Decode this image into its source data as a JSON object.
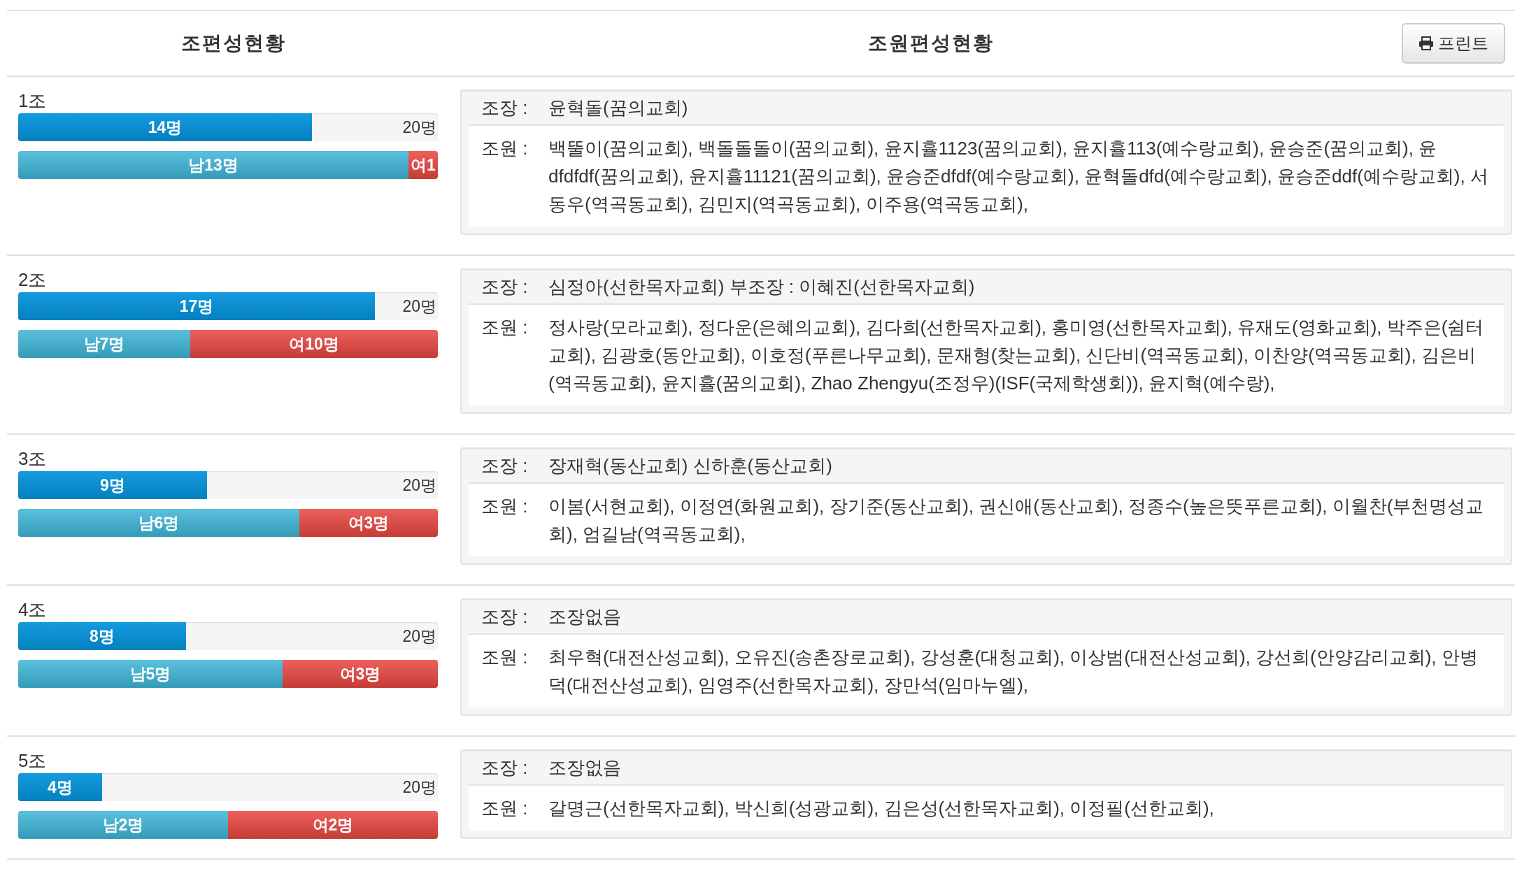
{
  "header": {
    "groups_title": "조편성현황",
    "members_title": "조원편성현황",
    "print_button": "프린트"
  },
  "groups": [
    {
      "name": "1조",
      "count": {
        "label": "14명",
        "level": 0.7
      },
      "capacity": "20명",
      "male": {
        "label": "남13명",
        "level": 0.93
      },
      "female": {
        "label": "여1",
        "level": 0.07
      },
      "leader_label": "조장 :",
      "leader": "윤혁돌(꿈의교회)",
      "members_label": "조원 :",
      "members": "백뚤이(꿈의교회), 백돌돌돌이(꿈의교회), 윤지휼1123(꿈의교회), 윤지휼113(예수랑교회), 윤승준(꿈의교회), 윤dfdfdf(꿈의교회), 윤지휼11121(꿈의교회), 윤승준dfdf(예수랑교회), 윤혁돌dfd(예수랑교회), 윤승준ddf(예수랑교회), 서동우(역곡동교회), 김민지(역곡동교회), 이주용(역곡동교회),"
    },
    {
      "name": "2조",
      "count": {
        "label": "17명",
        "level": 0.85
      },
      "capacity": "20명",
      "male": {
        "label": "남7명",
        "level": 0.41
      },
      "female": {
        "label": "여10명",
        "level": 0.59
      },
      "leader_label": "조장 :",
      "leader": "심정아(선한목자교회) 부조장 : 이혜진(선한목자교회)",
      "members_label": "조원 :",
      "members": "정사랑(모라교회), 정다운(은혜의교회), 김다희(선한목자교회), 홍미영(선한목자교회), 유재도(영화교회), 박주은(쉼터교회), 김광호(동안교회), 이호정(푸른나무교회), 문재형(찾는교회), 신단비(역곡동교회), 이찬양(역곡동교회), 김은비(역곡동교회), 윤지휼(꿈의교회), Zhao Zhengyu(조정우)(ISF(국제학생회)), 윤지혁(예수랑),"
    },
    {
      "name": "3조",
      "count": {
        "label": "9명",
        "level": 0.45
      },
      "capacity": "20명",
      "male": {
        "label": "남6명",
        "level": 0.67
      },
      "female": {
        "label": "여3명",
        "level": 0.33
      },
      "leader_label": "조장 :",
      "leader": "장재혁(동산교회) 신하훈(동산교회)",
      "members_label": "조원 :",
      "members": "이봄(서현교회), 이정연(화원교회), 장기준(동산교회), 권신애(동산교회), 정종수(높은뜻푸른교회), 이월찬(부천명성교회), 엄길남(역곡동교회),"
    },
    {
      "name": "4조",
      "count": {
        "label": "8명",
        "level": 0.4
      },
      "capacity": "20명",
      "male": {
        "label": "남5명",
        "level": 0.63
      },
      "female": {
        "label": "여3명",
        "level": 0.37
      },
      "leader_label": "조장 :",
      "leader": "조장없음",
      "members_label": "조원 :",
      "members": "최우혁(대전산성교회), 오유진(송촌장로교회), 강성훈(대청교회), 이상범(대전산성교회), 강선희(안양감리교회), 안병덕(대전산성교회), 임영주(선한목자교회), 장만석(임마누엘),"
    },
    {
      "name": "5조",
      "count": {
        "label": "4명",
        "level": 0.2
      },
      "capacity": "20명",
      "male": {
        "label": "남2명",
        "level": 0.5
      },
      "female": {
        "label": "여2명",
        "level": 0.5
      },
      "leader_label": "조장 :",
      "leader": "조장없음",
      "members_label": "조원 :",
      "members": "갈명근(선한목자교회), 박신희(성광교회), 김은성(선한목자교회), 이정필(선한교회),"
    }
  ]
}
